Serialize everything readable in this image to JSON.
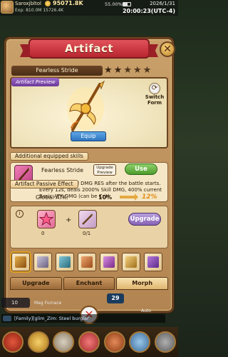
{
  "hud": {
    "player_name": "Saroxjbltol",
    "power": "95071.8K",
    "coords": "Exp: 810.0M 15726.4K",
    "battery": "55.00%",
    "date": "2026/1/31",
    "time": "20:00:23(UTC-4)"
  },
  "panel": {
    "title": "Artifact",
    "close_symbol": "✕"
  },
  "artifact": {
    "name": "Fearless Stride",
    "stars": 5,
    "stars_filled": 2,
    "preview_label": "Artifact Preview",
    "switch_form_label": "Switch Form",
    "equip_label": "Equip"
  },
  "skills": {
    "header": "Additional equipped skills",
    "skill_name": "Fearless Stride",
    "upgrade_preview_label": "Upgrade Preview",
    "use_label": "Use",
    "description": "Gains 10% Final DMG RES after the battle starts. Every 12s, deals 2000% Skill DMG, 400% current Basic ATK DMG (can be Crit)"
  },
  "passive": {
    "header": "Artifact Passive Effect",
    "stat_label": "Global ATK:",
    "current_value": "10%",
    "next_value": "12%",
    "materials": [
      {
        "name": "star-material",
        "count": "0"
      },
      {
        "name": "spear-material",
        "count": "0/1"
      }
    ],
    "upgrade_label": "Upgrade"
  },
  "tabs": [
    {
      "label": "Upgrade",
      "active": false
    },
    {
      "label": "Enchant",
      "active": false
    },
    {
      "label": "Morph",
      "active": true
    }
  ],
  "bottom": {
    "hp": "10",
    "level": "29",
    "mag_label": "Mag Furnace",
    "auto_label": "Auto",
    "close_symbol": "✕",
    "chat_text": "[Family][glim_Zim: Steel burglar"
  },
  "colors": {
    "title_ribbon": "#c8303a",
    "use_button": "#5aa83a",
    "upgrade_button": "#9a76c8",
    "equip_button": "#3f8bd4",
    "panel": "#c39660"
  }
}
